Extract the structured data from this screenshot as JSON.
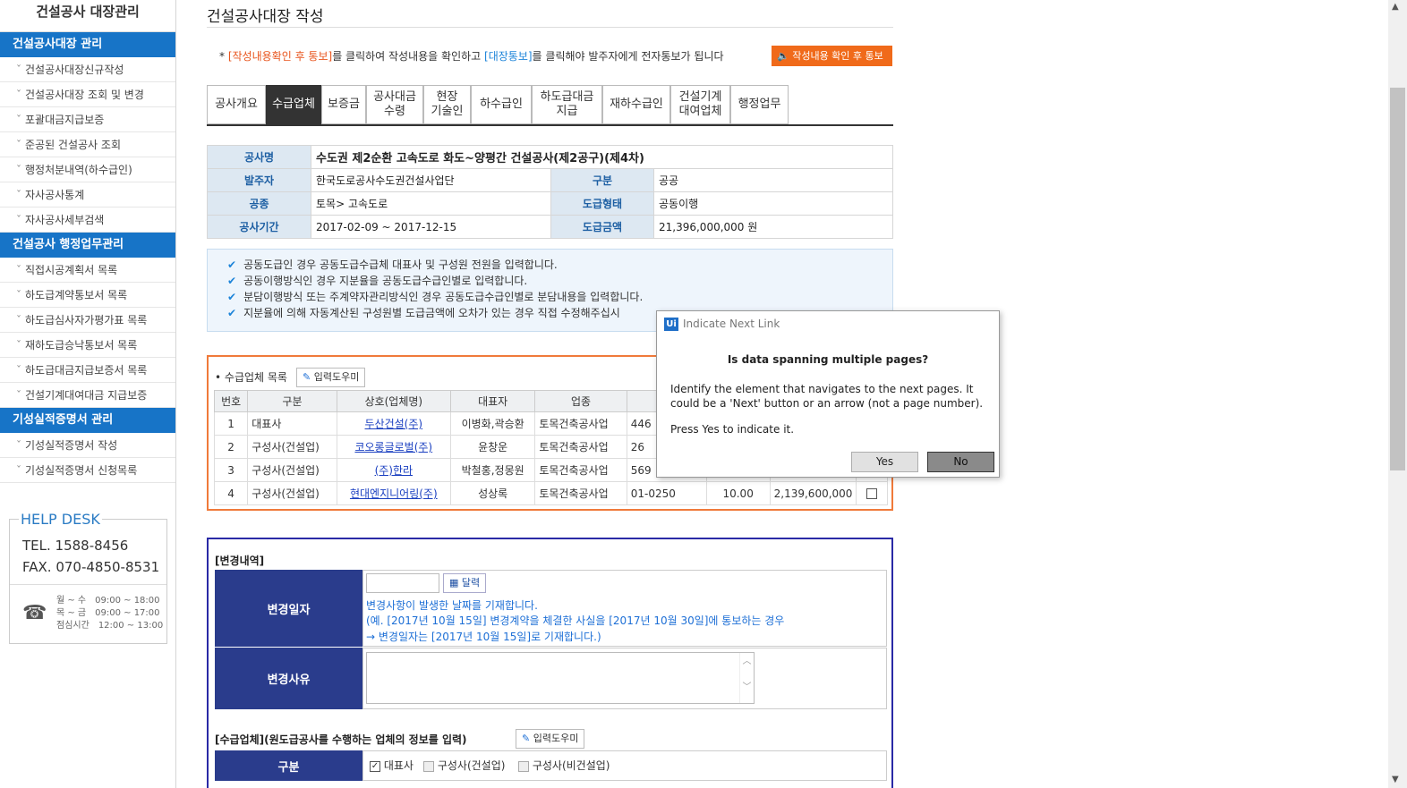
{
  "sidebar": {
    "app_title": "건설공사 대장관리",
    "groups": [
      {
        "title": "건설공사대장 관리",
        "items": [
          "건설공사대장신규작성",
          "건설공사대장 조회 및 변경",
          "포괄대금지급보증",
          "준공된 건설공사 조회",
          "행정처분내역(하수급인)",
          "자사공사통계",
          "자사공사세부검색"
        ]
      },
      {
        "title": "건설공사 행정업무관리",
        "items": [
          "직접시공계획서 목록",
          "하도급계약통보서 목록",
          "하도급심사자가평가표 목록",
          "재하도급승낙통보서 목록",
          "하도급대금지급보증서 목록",
          "건설기계대여대금 지급보증"
        ]
      },
      {
        "title": "기성실적증명서 관리",
        "items": [
          "기성실적증명서 작성",
          "기성실적증명서 신청목록"
        ]
      }
    ],
    "helpdesk": {
      "title": "HELP DESK",
      "tel": "TEL. 1588-8456",
      "fax": "FAX. 070-4850-8531",
      "hours": [
        {
          "label": "월 ~ 수",
          "value": "09:00 ~ 18:00"
        },
        {
          "label": "목 ~ 금",
          "value": "09:00 ~ 17:00"
        },
        {
          "label": "점심시간",
          "value": "12:00 ~ 13:00"
        }
      ]
    }
  },
  "main": {
    "page_title": "건설공사대장 작성",
    "notice": {
      "prefix": "* ",
      "confirm_link": "[작성내용확인 후 통보]",
      "mid": "를 클릭하여 작성내용을 확인하고 ",
      "ledger_link": "[대장통보]",
      "suffix": "를 클릭해야 발주자에게 전자통보가 됩니다"
    },
    "notify_button": "작성내용 확인 후 통보",
    "tabs": [
      "공사개요",
      "수급업체",
      "보증금",
      "공사대금\n수령",
      "현장\n기술인",
      "하수급인",
      "하도급대금\n지급",
      "재하수급인",
      "건설기계\n대여업체",
      "행정업무"
    ],
    "info": {
      "name_label": "공사명",
      "name_value": "수도권 제2순환 고속도로 화도~양평간 건설공사(제2공구)(제4차)",
      "orderer_label": "발주자",
      "orderer_value": "한국도로공사수도권건설사업단",
      "category_label": "구분",
      "category_value": "공공",
      "type_label": "공종",
      "type_value": "토목> 고속도로",
      "contract_form_label": "도급형태",
      "contract_form_value": "공동이행",
      "period_label": "공사기간",
      "period_value": "2017-02-09 ~ 2017-12-15",
      "amount_label": "도급금액",
      "amount_value": "21,396,000,000 원"
    },
    "guide": [
      "공동도급인 경우 공동도급수급체 대표사 및 구성원 전원을 입력합니다.",
      "공동이행방식인 경우 지분율을 공동도급수급인별로 입력합니다.",
      "분담이행방식 또는 주계약자관리방식인 경우 공동도급수급인별로 분담내용을 입력합니다.",
      "지분율에 의해 자동계산된 구성원별 도급금액에 오차가 있는 경우 직접 수정해주십시"
    ],
    "suppliers": {
      "label": "수급업체 목록",
      "helper": "입력도우미",
      "headers": [
        "번호",
        "구분",
        "상호(업체명)",
        "대표자",
        "업종",
        "업종"
      ],
      "rows": [
        {
          "no": "1",
          "kind": "대표사",
          "name": "두산건설(주)",
          "ceo": "이병화,곽승환",
          "industry": "토목건축공사업",
          "code": "446",
          "share": "",
          "amount": ""
        },
        {
          "no": "2",
          "kind": "구성사(건설업)",
          "name": "코오롱글로벌(주)",
          "ceo": "윤창운",
          "industry": "토목건축공사업",
          "code": "26",
          "share": "",
          "amount": ""
        },
        {
          "no": "3",
          "kind": "구성사(건설업)",
          "name": "(주)한라",
          "ceo": "박철홍,정몽원",
          "industry": "토목건축공사업",
          "code": "569",
          "share": "",
          "amount": ""
        },
        {
          "no": "4",
          "kind": "구성사(건설업)",
          "name": "현대엔지니어링(주)",
          "ceo": "성상록",
          "industry": "토목건축공사업",
          "code": "01-0250",
          "share": "10.00",
          "amount": "2,139,600,000"
        }
      ]
    },
    "change": {
      "section_title": "[변경내역]",
      "date_label": "변경일자",
      "calendar_button": "달력",
      "hint_1": "변경사항이 발생한 날짜를 기재합니다.",
      "hint_2": "(예. [2017년 10월 15일] 변경계약을 체결한 사실을 [2017년 10월 30일]에 통보하는 경우",
      "hint_3": "→ 변경일자는 [2017년 10월 15일]로 기재합니다.)",
      "reason_label": "변경사유",
      "supplier_section_title": "[수급업체](원도급공사를 수행하는 업체의 정보를 입력)",
      "supplier_helper": "입력도우미",
      "kind_label": "구분",
      "options": [
        "대표사",
        "구성사(건설업)",
        "구성사(비건설업)"
      ]
    }
  },
  "dialog": {
    "app_logo": "Ui",
    "title": "Indicate Next Link",
    "heading": "Is data spanning multiple pages?",
    "message": "Identify the element that navigates to the next pages. It could be a 'Next' button or an arrow (not a page number).",
    "press": "Press Yes to indicate it.",
    "yes": "Yes",
    "no": "No"
  }
}
